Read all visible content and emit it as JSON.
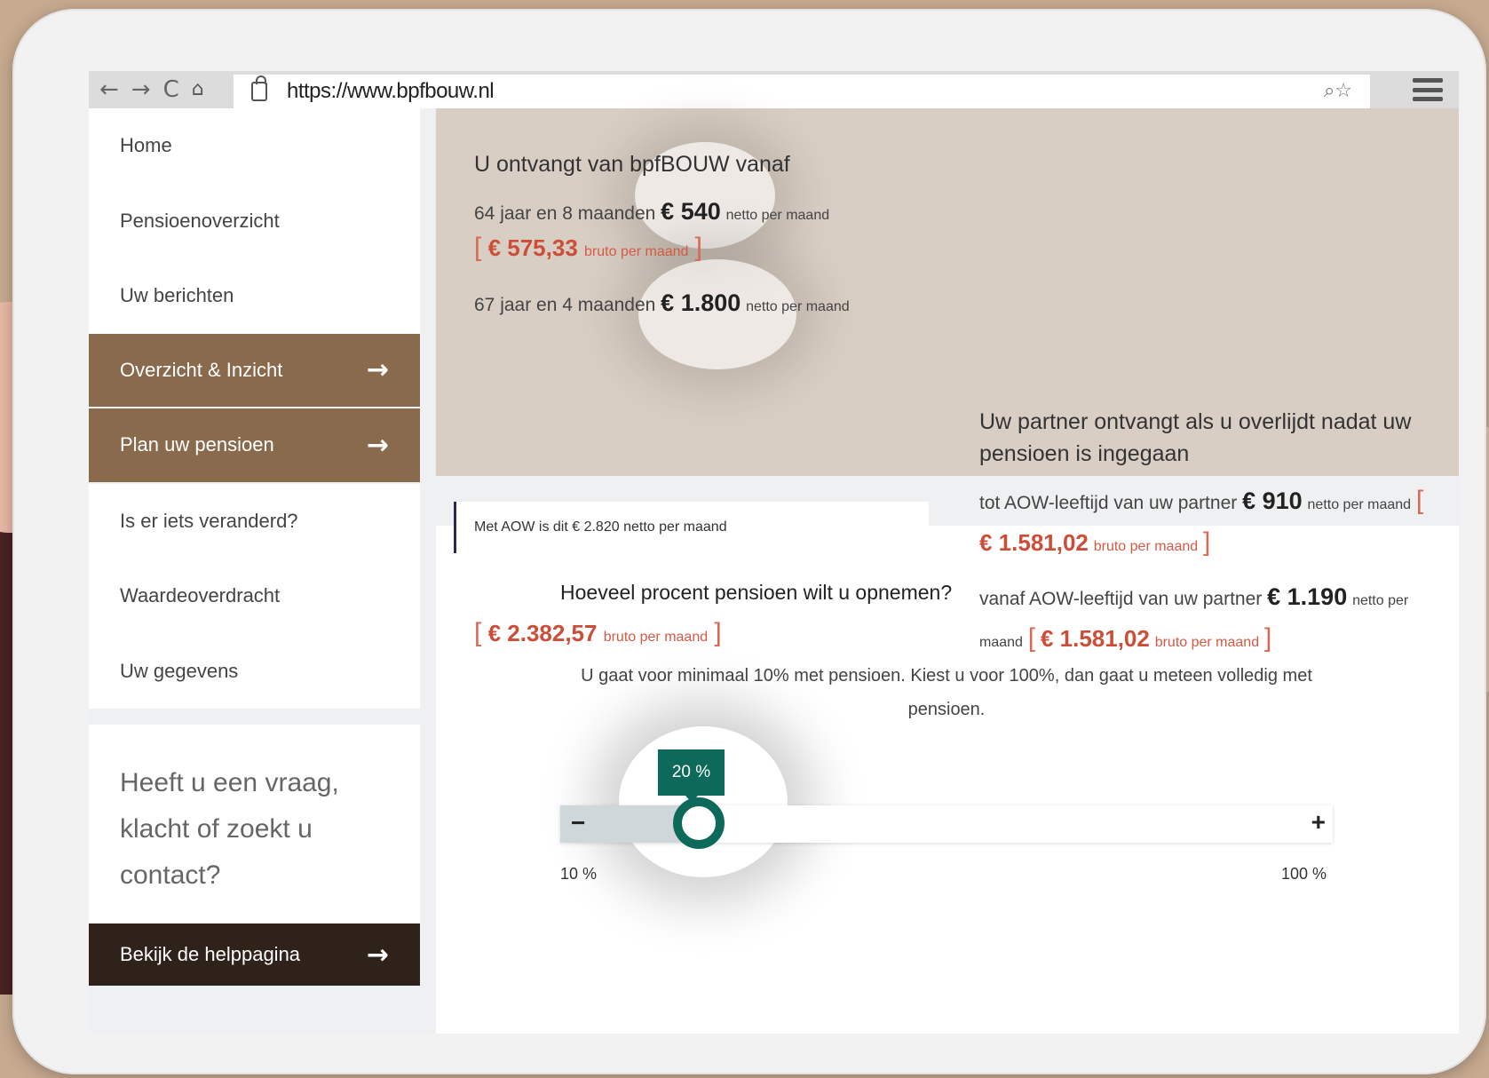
{
  "browser": {
    "url": "https://www.bpfbouw.nl"
  },
  "sidebar": {
    "items": [
      {
        "label": "Home"
      },
      {
        "label": "Pensioenoverzicht"
      },
      {
        "label": "Uw berichten"
      },
      {
        "label": "Overzicht & Inzicht"
      },
      {
        "label": "Plan uw pensioen"
      },
      {
        "label": "Is er iets veranderd?"
      },
      {
        "label": "Waardeoverdracht"
      },
      {
        "label": "Uw gegevens"
      }
    ],
    "help_text": "Heeft u een vraag, klacht of zoekt u contact?",
    "help_button": "Bekijk de helppagina"
  },
  "summary": {
    "left_heading": "U ontvangt van bpfBOUW vanaf",
    "row1_label": "64 jaar en 8 maanden",
    "row1_amount": "€ 540",
    "row1_unit": "netto per maand",
    "row1_bruto": "€ 575,33",
    "row1_bruto_unit": "bruto per maand",
    "row2_label": "67 jaar en 4 maanden",
    "row2_amount": "€ 1.800",
    "row2_unit": "netto per maand",
    "aow_text": "Met AOW is dit  € 2.820 netto per maand",
    "aow_bruto": "€ 2.382,57",
    "aow_bruto_unit": "bruto per maand",
    "right_heading": "Uw partner ontvangt als u overlijdt nadat uw pensioen is ingegaan",
    "partner1_label": "tot AOW-leeftijd van uw partner",
    "partner1_amount": "€ 910",
    "partner1_unit": "netto per maand",
    "partner1_bruto": "€ 1.581,02",
    "partner1_bruto_unit": "bruto per maand",
    "partner2_label": "vanaf AOW-leeftijd van uw partner",
    "partner2_amount": "€ 1.190",
    "partner2_unit": "netto per maand",
    "partner2_bruto": "€ 1.581,02",
    "partner2_bruto_unit": "bruto per maand"
  },
  "plan": {
    "question": "Hoeveel procent pensioen wilt u opnemen?",
    "info": "U gaat voor minimaal 10% met pensioen. Kiest u voor 100%, dan gaat u meteen volledig met pensioen.",
    "slider_value_label": "20 %",
    "slider_value_fraction": 0.111,
    "min_label": "10 %",
    "max_label": "100 %",
    "minus": "−",
    "plus": "+"
  },
  "colors": {
    "accent_brown": "#8a6a4c",
    "dark_button": "#2e221a",
    "summary_bg": "#d9cec3",
    "bruto_red": "#cc4e38",
    "slider_green": "#0d6a5a"
  }
}
